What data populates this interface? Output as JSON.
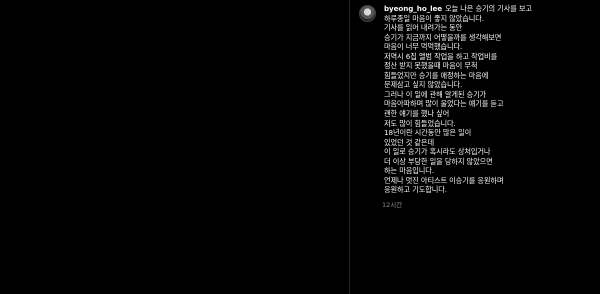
{
  "post": {
    "username": "byeong_ho_lee",
    "caption_first_line": "오늘 나은 승기의 기사를 보고",
    "caption_lines": [
      "하루종일 마음이 좋지 않았습니다.",
      "기사를 읽어 내려가는 동안",
      "승기가 지금까지 어떻을까를 생각해보면",
      "마음이 너무 먹먹했습니다.",
      "저역시 6집 앨범 작업을 하고 작업비를",
      "정산 받지 못했을때 마음이 무척",
      "힘들었지만 승기를 애정하는 마음에",
      "문제삼고 싶지 않았습니다.",
      "그러나 이 일에 관해 알게된 승기가",
      "마음아파하며 많이 울었다는 얘기를 듣고",
      "괜한 얘기를 했나 싶어",
      "저도 많이 힘들었습니다.",
      "18년이란 시간동안 많은 일이",
      "있었던 것 같은데",
      "이 일로 승기가 혹시라도 상처입거나",
      "더 이상 부당한 일을 당하지 않았으면",
      "하는 마음입니다.",
      "언제나 멋진 아티스트 이승기를 응원하며",
      "응원하고 기도합니다."
    ],
    "timestamp": "12시간"
  },
  "colors": {
    "background": "#000000",
    "text": "#f5f5f5",
    "muted": "#8e8e8e",
    "divider": "#262626"
  }
}
